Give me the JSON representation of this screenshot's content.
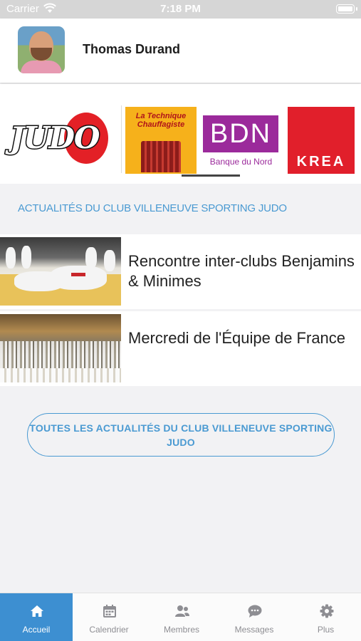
{
  "status_bar": {
    "carrier": "Carrier",
    "time": "7:18 PM"
  },
  "profile": {
    "name": "Thomas Durand"
  },
  "sponsors": {
    "club_logo_text": "JUDO",
    "items": [
      {
        "name": "La Technique Chauffagiste",
        "line1": "La Technique",
        "line2": "Chauffagiste"
      },
      {
        "name": "BDN",
        "subtitle": "Banque du Nord"
      },
      {
        "name": "KREA"
      }
    ]
  },
  "news": {
    "section_title": "ACTUALITÉS DU CLUB VILLENEUVE SPORTING JUDO",
    "items": [
      {
        "title": "Rencontre inter-clubs Benjamins & Minimes"
      },
      {
        "title": "Mercredi de l'Équipe de France"
      }
    ],
    "all_button": "TOUTES LES ACTUALITÉS DU CLUB VILLENEUVE SPORTING JUDO"
  },
  "tabs": [
    {
      "label": "Accueil",
      "icon": "home-icon",
      "active": true
    },
    {
      "label": "Calendrier",
      "icon": "calendar-icon",
      "active": false
    },
    {
      "label": "Membres",
      "icon": "members-icon",
      "active": false
    },
    {
      "label": "Messages",
      "icon": "messages-icon",
      "active": false
    },
    {
      "label": "Plus",
      "icon": "gear-icon",
      "active": false
    }
  ],
  "colors": {
    "accent": "#3d8fd1",
    "link": "#4a9ad2",
    "tab_inactive": "#8e8e93"
  }
}
